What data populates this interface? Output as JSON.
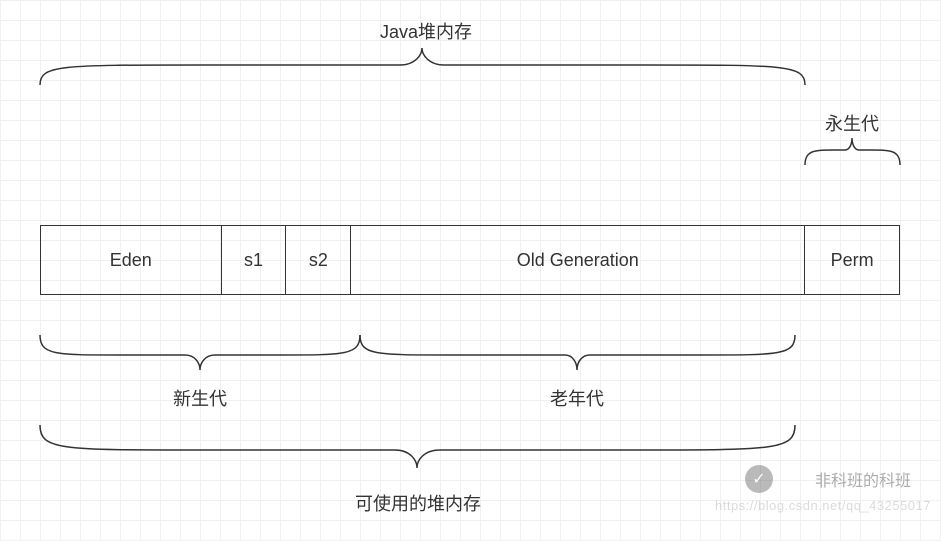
{
  "title": "Java堆内存",
  "permgen_label": "永生代",
  "boxes": {
    "eden": "Eden",
    "s1": "s1",
    "s2": "s2",
    "old": "Old Generation",
    "perm": "Perm"
  },
  "young_label": "新生代",
  "old_label": "老年代",
  "usable_label": "可使用的堆内存",
  "watermark": {
    "text": "非科班的科班",
    "url": "https://blog.csdn.net/qq_43255017"
  },
  "chart_data": {
    "type": "table",
    "description": "Java heap memory layout diagram showing generational GC regions",
    "regions": [
      {
        "name": "Eden",
        "group": "新生代 (Young Generation)",
        "relative_width": 180
      },
      {
        "name": "s1",
        "group": "新生代 (Young Generation)",
        "relative_width": 65
      },
      {
        "name": "s2",
        "group": "新生代 (Young Generation)",
        "relative_width": 65
      },
      {
        "name": "Old Generation",
        "group": "老年代 (Old Generation)",
        "relative_width": 455
      },
      {
        "name": "Perm",
        "group": "永生代 (Permanent Generation)",
        "relative_width": 95
      }
    ],
    "top_span": {
      "label": "Java堆内存",
      "covers": [
        "Eden",
        "s1",
        "s2",
        "Old Generation"
      ]
    },
    "bottom_spans": [
      {
        "label": "新生代",
        "covers": [
          "Eden",
          "s1",
          "s2"
        ]
      },
      {
        "label": "老年代",
        "covers": [
          "Old Generation"
        ]
      },
      {
        "label": "可使用的堆内存",
        "covers": [
          "Eden",
          "s1",
          "s2",
          "Old Generation"
        ]
      }
    ]
  }
}
